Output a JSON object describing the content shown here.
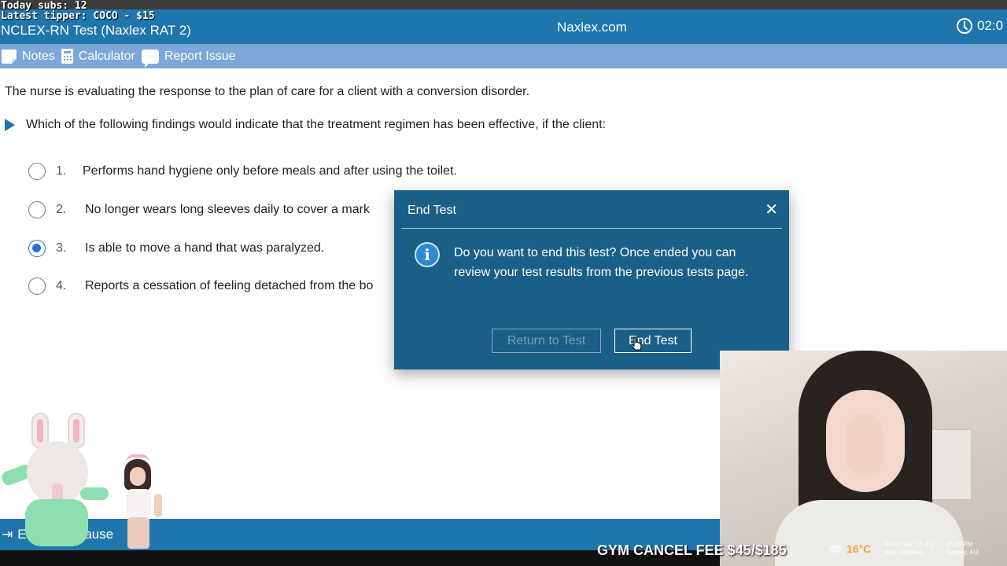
{
  "stream_overlay": {
    "subs": "Today subs: 12",
    "tipper": "Latest tipper: COCO - $15",
    "ticker": "GYM CANCEL FEE $45/$185",
    "weather": {
      "temp": "16°C",
      "feels_like": "Feels like: 13.3°C",
      "condition": "Rain showers",
      "time": "05:56 PM",
      "location": "Sydney, AU"
    }
  },
  "header": {
    "title": "NCLEX-RN Test (Naxlex RAT 2)",
    "site": "Naxlex.com",
    "timer": "02:0",
    "accent": "#1e76ad"
  },
  "toolbar": {
    "notes": "Notes",
    "calculator": "Calculator",
    "report": "Report Issue"
  },
  "question": {
    "stem": "The nurse is evaluating the response to the plan of care for a client with a conversion disorder.",
    "prompt": "Which of the following findings would indicate that the treatment regimen has been effective, if the client:",
    "options": [
      {
        "num": "1.",
        "text": "Performs hand hygiene only before meals and after using the toilet.",
        "selected": false
      },
      {
        "num": "2.",
        "text": "No longer wears long sleeves daily to cover a mark",
        "selected": false
      },
      {
        "num": "3.",
        "text": "Is able to move a hand that was paralyzed.",
        "selected": true
      },
      {
        "num": "4.",
        "text": "Reports a cessation of feeling detached from the bo",
        "selected": false
      }
    ]
  },
  "modal": {
    "title": "End Test",
    "close": "✕",
    "message": "Do you want to end this test? Once ended you can review your test results from the previous tests page.",
    "return_label": "Return to Test",
    "end_label": "End Test",
    "color": "#1a5f88"
  },
  "bottom_bar": {
    "end_label": "En",
    "pause_label": "Pause"
  }
}
